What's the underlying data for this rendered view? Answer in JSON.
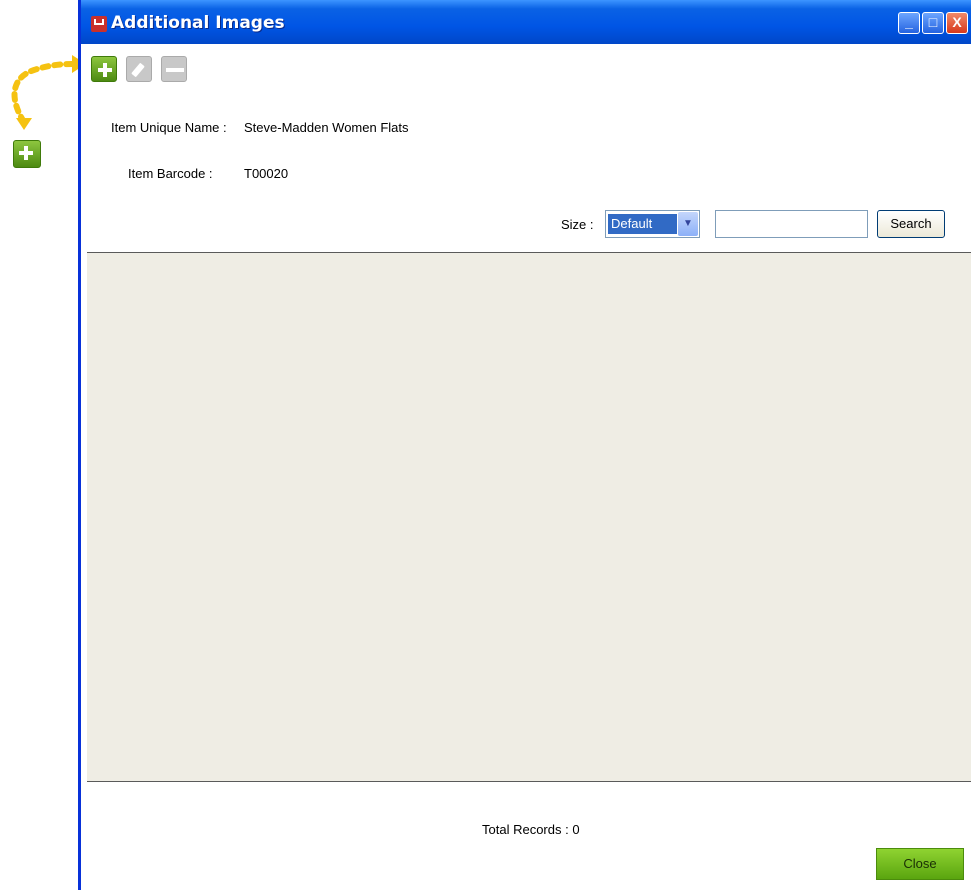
{
  "window": {
    "title": "Additional Images",
    "controls": {
      "minimize": "_",
      "maximize": "□",
      "close": "X"
    }
  },
  "toolbar": {
    "add_icon": "plus-icon",
    "edit_icon": "pencil-icon",
    "delete_icon": "minus-icon"
  },
  "item": {
    "unique_name_label": "Item Unique Name :",
    "unique_name_value": "Steve-Madden Women Flats",
    "barcode_label": "Item Barcode :",
    "barcode_value": "T00020"
  },
  "filter": {
    "size_label": "Size :",
    "size_selected": "Default",
    "search_value": "",
    "search_button": "Search"
  },
  "footer": {
    "total_records": "Total Records : 0",
    "close_button": "Close"
  },
  "colors": {
    "accent_green": "#6cb01e",
    "title_blue": "#0a5ad6",
    "grid_bg": "#efede4",
    "callout_yellow": "#f5c211"
  }
}
